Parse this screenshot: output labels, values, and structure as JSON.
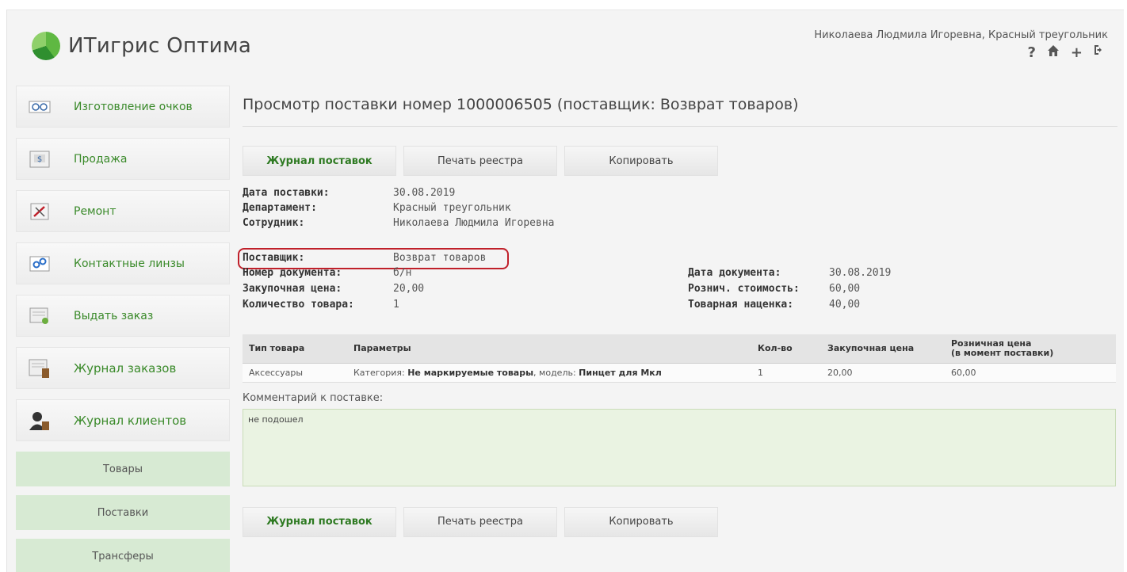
{
  "app": {
    "title": "ИТигрис Оптима"
  },
  "header": {
    "user": "Николаева Людмила Игоревна, Красный треугольник",
    "icons": [
      {
        "name": "help-icon",
        "glyph": "?"
      },
      {
        "name": "home-icon",
        "glyph": "🏠"
      },
      {
        "name": "add-icon",
        "glyph": "+"
      },
      {
        "name": "logout-icon",
        "glyph": "⇥"
      }
    ]
  },
  "sidebar": {
    "items": [
      {
        "label": "Изготовление очков",
        "icon": "glasses-icon"
      },
      {
        "label": "Продажа",
        "icon": "sale-icon"
      },
      {
        "label": "Ремонт",
        "icon": "repair-icon"
      },
      {
        "label": "Контактные линзы",
        "icon": "contact-lens-icon"
      },
      {
        "label": "Выдать заказ",
        "icon": "issue-order-icon"
      },
      {
        "label": "Журнал заказов",
        "icon": "orders-journal-icon"
      },
      {
        "label": "Журнал клиентов",
        "icon": "clients-journal-icon"
      }
    ],
    "sub_items": [
      "Товары",
      "Поставки",
      "Трансферы"
    ]
  },
  "page": {
    "title": "Просмотр поставки номер 1000006505 (поставщик: Возврат товаров)",
    "buttons": {
      "journal": "Журнал поставок",
      "print": "Печать реестра",
      "copy": "Копировать"
    },
    "fields": {
      "delivery_date_label": "Дата поставки:",
      "delivery_date": "30.08.2019",
      "department_label": "Департамент:",
      "department": "Красный треугольник",
      "employee_label": "Сотрудник:",
      "employee": "Николаева Людмила Игоревна",
      "supplier_label": "Поставщик:",
      "supplier": "Возврат товаров",
      "doc_number_label": "Номер документа:",
      "doc_number": "б/н",
      "purchase_price_label": "Закупочная цена:",
      "purchase_price": "20,00",
      "quantity_label": "Количество товара:",
      "quantity": "1",
      "doc_date_label": "Дата документа:",
      "doc_date": "30.08.2019",
      "retail_value_label": "Рознич. стоимость:",
      "retail_value": "60,00",
      "markup_label": "Товарная наценка:",
      "markup": "40,00"
    },
    "table": {
      "headers": {
        "type": "Тип товара",
        "params": "Параметры",
        "qty": "Кол-во",
        "purchase": "Закупочная цена",
        "retail_line1": "Розничная цена",
        "retail_line2": "(в момент поставки)"
      },
      "rows": [
        {
          "type": "Аксессуары",
          "category_label": "Категория:",
          "category": "Не маркируемые товары",
          "model_label": "модель:",
          "model": "Пинцет для Мкл",
          "qty": "1",
          "purchase": "20,00",
          "retail": "60,00"
        }
      ]
    },
    "comment_label": "Комментарий к поставке:",
    "comment": "не подошел"
  },
  "colors": {
    "accent_green": "#3a8a2a",
    "highlight_red": "#c0202a",
    "comment_bg": "#eaf3e2"
  }
}
